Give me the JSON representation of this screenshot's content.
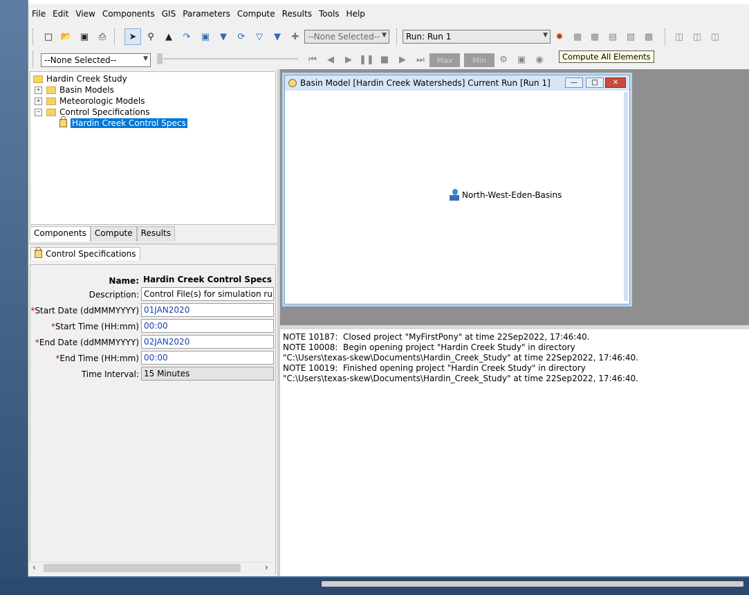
{
  "menu": [
    "File",
    "Edit",
    "View",
    "Components",
    "GIS",
    "Parameters",
    "Compute",
    "Results",
    "Tools",
    "Help"
  ],
  "toolbar": {
    "element_select": "--None Selected--",
    "run_select": "Run: Run 1",
    "tooltip": "Compute All Elements"
  },
  "toolbar2": {
    "result_select": "--None Selected--",
    "max_label": "Max",
    "min_label": "Min"
  },
  "tree": {
    "root": "Hardin Creek Study",
    "items": [
      "Basin Models",
      "Meteorologic Models",
      "Control Specifications"
    ],
    "child": "Hardin Creek Control Specs"
  },
  "tabs": [
    "Components",
    "Compute",
    "Results"
  ],
  "editor": {
    "tab_label": "Control Specifications",
    "name_label": "Name:",
    "name_value": "Hardin Creek Control Specs",
    "description_label": "Description:",
    "description_value": "Control File(s) for simulation runs",
    "start_date_label": "Start Date (ddMMMYYYY)",
    "start_date_value": "01JAN2020",
    "start_time_label": "Start Time (HH:mm)",
    "start_time_value": "00:00",
    "end_date_label": "End Date (ddMMMYYYY)",
    "end_date_value": "02JAN2020",
    "end_time_label": "End Time (HH:mm)",
    "end_time_value": "00:00",
    "interval_label": "Time Interval:",
    "interval_value": "15 Minutes"
  },
  "basin_window": {
    "title": "Basin Model [Hardin Creek Watersheds] Current Run [Run 1]",
    "element_label": "North-West-Eden-Basins"
  },
  "log": {
    "lines": [
      "NOTE 10187:  Closed project \"MyFirstPony\" at time 22Sep2022, 17:46:40.",
      "NOTE 10008:  Begin opening project \"Hardin Creek Study\" in directory",
      "\"C:\\Users\\texas-skew\\Documents\\Hardin_Creek_Study\" at time 22Sep2022, 17:46:40.",
      "NOTE 10019:  Finished opening project \"Hardin Creek Study\" in directory",
      "\"C:\\Users\\texas-skew\\Documents\\Hardin_Creek_Study\" at time 22Sep2022, 17:46:40."
    ]
  }
}
